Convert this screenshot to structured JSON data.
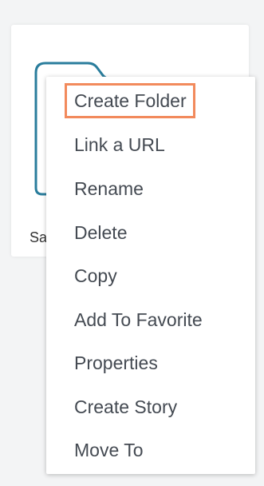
{
  "folder": {
    "name": "Sa",
    "icon": "folder-icon",
    "icon_color": "#2a7d9c"
  },
  "context_menu": {
    "highlight_color": "#f28a5c",
    "items": [
      {
        "label": "Create Folder"
      },
      {
        "label": "Link a URL"
      },
      {
        "label": "Rename"
      },
      {
        "label": "Delete"
      },
      {
        "label": "Copy"
      },
      {
        "label": "Add To Favorite"
      },
      {
        "label": "Properties"
      },
      {
        "label": "Create Story"
      },
      {
        "label": "Move To"
      }
    ]
  }
}
